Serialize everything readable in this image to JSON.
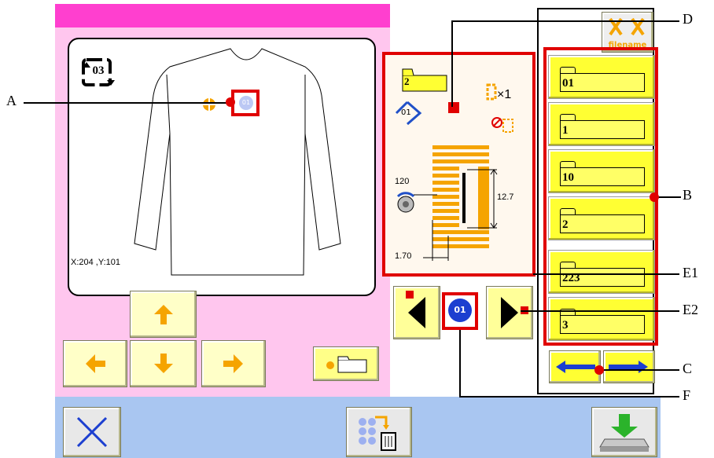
{
  "sketch": {
    "repeat_badge": "03",
    "coord_readout": "X:204 ,Y:101",
    "point_label": "01"
  },
  "pattern": {
    "folder_label": "2",
    "sequence_label": "01",
    "multiplier": "×1",
    "rotation_value": "120",
    "height_value": "12.7",
    "width_value": "1.70"
  },
  "pattern_number": "01",
  "filename_button": {
    "label": "filename"
  },
  "folders": [
    {
      "label": "01"
    },
    {
      "label": "1"
    },
    {
      "label": "10"
    },
    {
      "label": "2"
    },
    {
      "label": "223"
    },
    {
      "label": "3"
    }
  ],
  "callouts": {
    "A": "A",
    "B": "B",
    "C": "C",
    "D": "D",
    "E1": "E1",
    "E2": "E2",
    "F": "F"
  },
  "colors": {
    "pink_header": "#ff3fcf",
    "pink_panel": "#ffc6ee",
    "blue_bar": "#a9c6f1",
    "yellow_button": "#ffff33",
    "callout_red": "#e00000",
    "arrow_orange": "#f5a400"
  }
}
